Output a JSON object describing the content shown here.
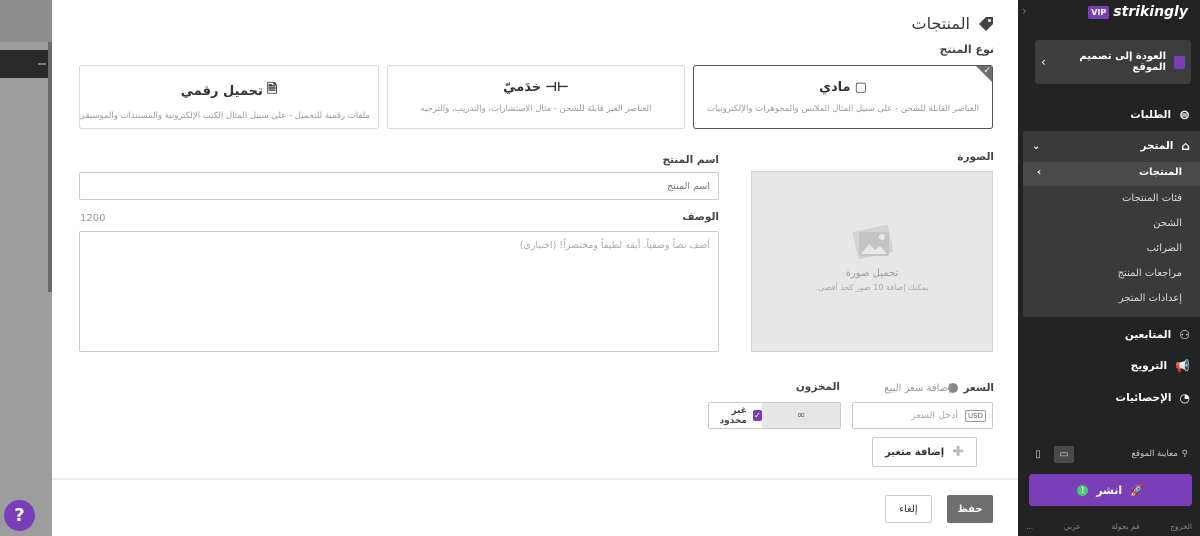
{
  "modal": {
    "title": "المنتجات",
    "product_type_label": "نوع المنتج",
    "types": [
      {
        "name": "مادي",
        "desc": "العناصر القابلة للشحن - على سبيل المثال الملابس والمجوهرات والإلكترونيات"
      },
      {
        "name": "خدَميّ",
        "desc": "العناصر الغير قابلة للشحن - مثال الاستشارات، والتدريب، والترجيه"
      },
      {
        "name": "تحميل رقمي",
        "desc": "ملفات رقمية للتحميل - على سبيل المثال الكتب الإلكترونية والمستندات والموسيقى"
      }
    ],
    "image_label": "الصورة",
    "image_upload": "تحميل صورة",
    "image_note": "يمكنك إضافة 10 صور كحد أقصى.",
    "name_label": "اسم المنتج",
    "name_placeholder": "اسم المنتج",
    "desc_label": "الوصف",
    "desc_counter": "1200",
    "desc_placeholder": "أضف نصاً وصفياً. أبقه لطيفاً ومختصراً! (اختياري)",
    "price_label": "السعر",
    "add_sale_price": "إضافة سعر البيع",
    "price_placeholder": "أدخل السعر",
    "currency": "USD",
    "stock_label": "المخزون",
    "stock_value": "∞",
    "unlimited_label": "غير محدود",
    "add_variant": "إضافة متغير",
    "save": "حفظ",
    "cancel": "إلغاء"
  },
  "sidebar": {
    "brand": "strikingly",
    "vip": "VIP",
    "back_to_design": "العودة إلى تصميم الموقع",
    "orders": "الطلبات",
    "store": "المتجر",
    "store_items": [
      "المنتجات",
      "فئات المنتجات",
      "الشحن",
      "الضرائب",
      "مراجعات المنتج",
      "إعدادات المتجر"
    ],
    "followers": "المتابعين",
    "promotion": "الترويج",
    "analytics": "الإحصائيات",
    "site_preview": "معاينة الموقع",
    "publish": "انشر",
    "footer_links": [
      "الخروج",
      "قم بجولة",
      "عربي",
      "..."
    ]
  },
  "help": "?"
}
